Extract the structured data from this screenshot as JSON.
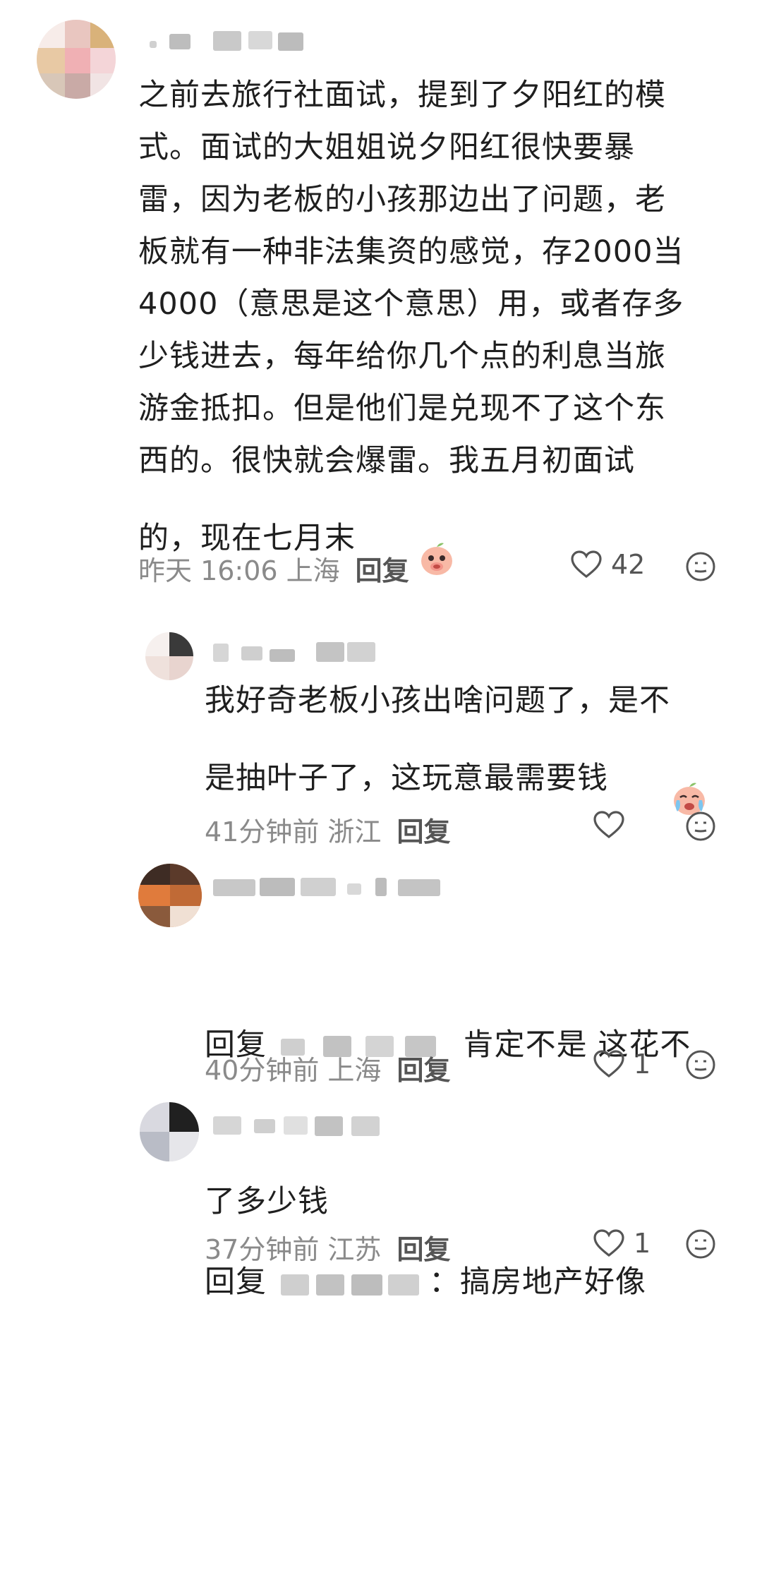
{
  "comments": [
    {
      "text": "之前去旅行社面试，提到了夕阳红的模\n式。面试的大姐姐说夕阳红很快要暴\n雷，因为老板的小孩那边出了问题，老\n板就有一种非法集资的感觉，存2000当\n4000（意思是这个意思）用，或者存多\n少钱进去，每年给你几个点的利息当旅\n游金抵扣。但是他们是兑现不了这个东\n西的。很快就会爆雷。我五月初面试\n的，现在七月末",
      "meta": "昨天 16:06 上海",
      "reply_label": "回复",
      "likes": "42"
    },
    {
      "text": "我好奇老板小孩出啥问题了，是不\n是抽叶子了，这玩意最需要钱",
      "meta": "41分钟前 浙江",
      "reply_label": "回复",
      "likes": ""
    },
    {
      "prefix": "回复",
      "text_after": " 肯定不是 这花不",
      "text_line2": "了多少钱",
      "meta": "40分钟前 上海",
      "reply_label": "回复",
      "likes": "1"
    },
    {
      "prefix": "回复",
      "text_after": "：搞房地产好像",
      "meta": "37分钟前 江苏",
      "reply_label": "回复",
      "likes": "1"
    }
  ],
  "icons": {
    "like": "heart-outline-icon",
    "react": "smiley-face-icon",
    "emoji1": "peach-covering-mouth-emoji",
    "emoji2": "peach-crying-emoji"
  },
  "colors": {
    "text": "#1f1f1f",
    "meta": "#8a8a8a",
    "icon": "#555555"
  }
}
